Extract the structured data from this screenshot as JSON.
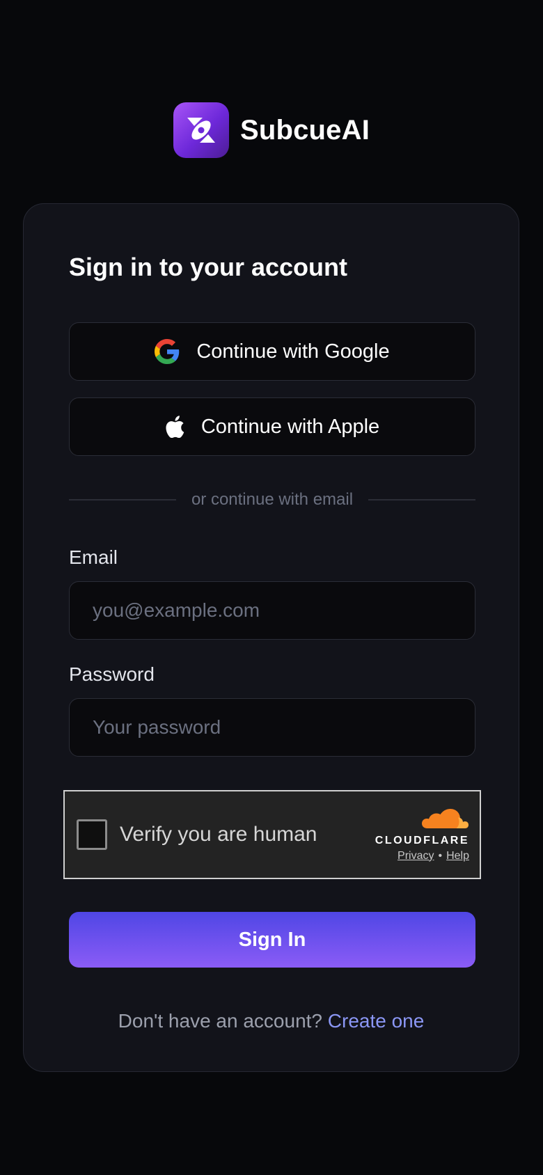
{
  "brand": {
    "name": "SubcueAI",
    "logo_icon": "subcue-logo-icon"
  },
  "card": {
    "title": "Sign in to your account",
    "google_button": {
      "label": "Continue with Google",
      "icon": "google-icon"
    },
    "apple_button": {
      "label": "Continue with Apple",
      "icon": "apple-icon"
    },
    "divider_text": "or continue with email",
    "email": {
      "label": "Email",
      "placeholder": "you@example.com",
      "value": ""
    },
    "password": {
      "label": "Password",
      "placeholder": "Your password",
      "value": ""
    },
    "captcha": {
      "label": "Verify you are human",
      "provider": "CLOUDFLARE",
      "privacy_link": "Privacy",
      "separator": "•",
      "help_link": "Help",
      "checked": false
    },
    "submit_label": "Sign In",
    "footer": {
      "prompt": "Don't have an account?",
      "link": "Create one"
    }
  },
  "colors": {
    "background": "#07080b",
    "card": "#12131a",
    "accent_start": "#4f46e5",
    "accent_end": "#8b5cf6",
    "link": "#8b97f5"
  }
}
